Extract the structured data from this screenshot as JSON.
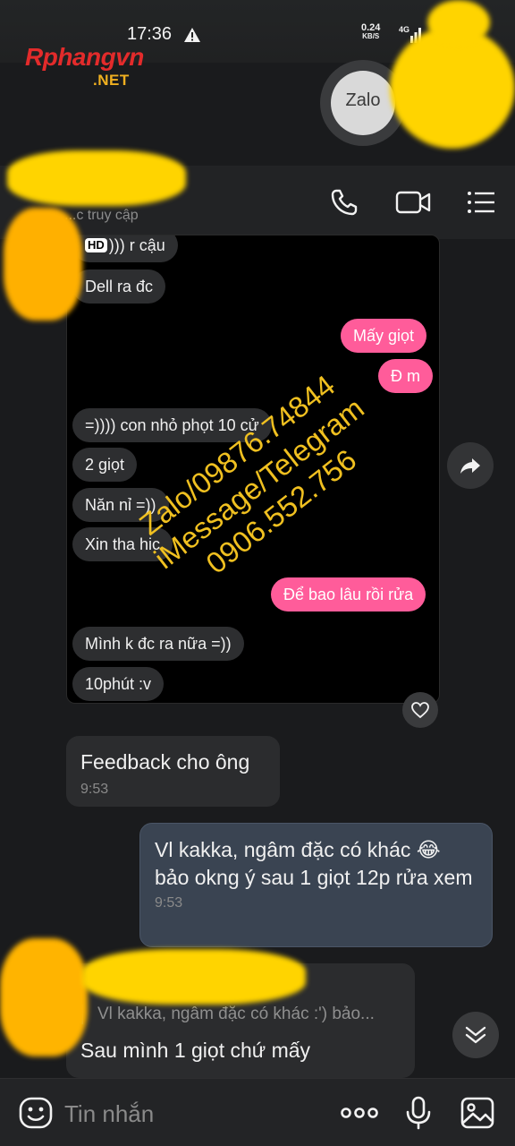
{
  "status_bar": {
    "time": "17:36",
    "net_speed_value": "0.24",
    "net_speed_unit": "KB/S",
    "net_type": "4G"
  },
  "watermark": {
    "logo": "Rphangvn",
    "logo_suffix": ".NET",
    "contact_line1": "Zalo/09876.74844",
    "contact_line2": "iMessage/Telegram",
    "contact_line3": "0906.552.756"
  },
  "zalo_badge": "Zalo",
  "header": {
    "subtitle": "...c truy cập"
  },
  "embedded_chat": {
    "messages": [
      {
        "dir": "in",
        "text": "))) r cậu",
        "hd": "HD"
      },
      {
        "dir": "in",
        "text": "Dell ra đc"
      },
      {
        "dir": "out",
        "text": "Mấy giọt"
      },
      {
        "dir": "out",
        "text": "Đ m"
      },
      {
        "dir": "in",
        "text": "=)))) con nhỏ phọt 10 cử"
      },
      {
        "dir": "in",
        "text": "2 giọt"
      },
      {
        "dir": "in",
        "text": "Năn nỉ =))"
      },
      {
        "dir": "in",
        "text": "Xin tha hic"
      },
      {
        "dir": "out",
        "text": "Để bao lâu rồi rửa"
      },
      {
        "dir": "in",
        "text": "Mình k đc ra nữa =))"
      },
      {
        "dir": "in",
        "text": "10phút :v"
      }
    ]
  },
  "messages": [
    {
      "dir": "in",
      "text": "Feedback cho ông",
      "time": "9:53"
    },
    {
      "dir": "out",
      "text": "Vl kakka, ngâm đặc có khác 😂 bảo okng ý sau 1 giọt 12p rửa xem",
      "time": "9:53"
    },
    {
      "dir": "in",
      "quote": "Vl kakka, ngâm đặc có khác :')  bảo...",
      "text": "Sau mình 1 giọt chứ mấy"
    }
  ],
  "input": {
    "placeholder": "Tin nhắn"
  },
  "colors": {
    "background": "#1a1b1d",
    "incoming_bubble": "#2b2c2e",
    "outgoing_bubble": "#3a4452",
    "pink_bubble": "#ff5c9a",
    "watermark": "#f0c020",
    "censor": "#ffd400",
    "accent_blue": "#2e7cf6"
  },
  "icons": [
    "warning-icon",
    "signal-icon",
    "phone-icon",
    "video-call-icon",
    "menu-icon",
    "share-icon",
    "heart-icon",
    "chevron-down-icon",
    "emoji-icon",
    "more-icon",
    "mic-icon",
    "image-icon"
  ]
}
